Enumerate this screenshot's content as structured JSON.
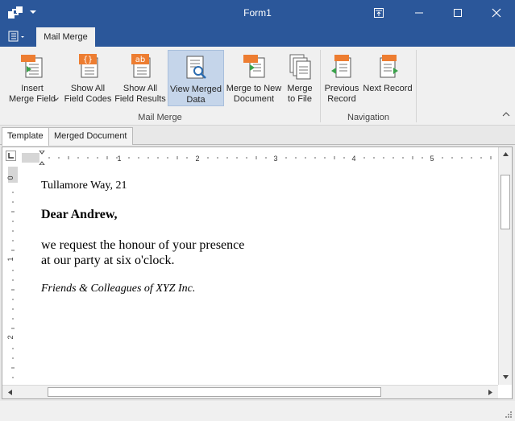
{
  "window": {
    "title": "Form1",
    "controls": [
      "restore-ribbon-icon",
      "minimize-icon",
      "maximize-icon",
      "close-icon"
    ]
  },
  "ribbon": {
    "active_tab": "Mail Merge",
    "buttons": [
      {
        "label": "Insert\nMerge Field",
        "icon": "insert-merge-field-icon",
        "has_dropdown": true
      },
      {
        "label": "Show All\nField Codes",
        "icon": "field-codes-icon"
      },
      {
        "label": "Show All\nField Results",
        "icon": "field-results-icon"
      },
      {
        "label": "View Merged\nData",
        "icon": "view-merged-data-icon",
        "active": true
      },
      {
        "label": "Merge to New\nDocument",
        "icon": "merge-to-document-icon"
      },
      {
        "label": "Merge\nto File",
        "icon": "merge-to-file-icon"
      },
      {
        "label": "Previous\nRecord",
        "icon": "previous-record-icon"
      },
      {
        "label": "Next Record",
        "icon": "next-record-icon"
      }
    ],
    "groups": [
      "Mail Merge",
      "Navigation"
    ]
  },
  "doc_tabs": [
    "Template",
    "Merged Document"
  ],
  "ruler": {
    "h_numbers": [
      "1",
      "2",
      "3",
      "4",
      "5"
    ],
    "v_numbers": [
      "0",
      "1",
      "2"
    ]
  },
  "document": {
    "address": "Tullamore Way, 21",
    "greeting": "Dear Andrew,",
    "body_line1": "we request the honour of your presence",
    "body_line2": "at our party at six o'clock.",
    "signature": "Friends & Colleagues of XYZ Inc."
  },
  "colors": {
    "titlebar": "#2b579a",
    "accent_orange": "#ed7d31",
    "active_button": "#c5d5ea"
  }
}
